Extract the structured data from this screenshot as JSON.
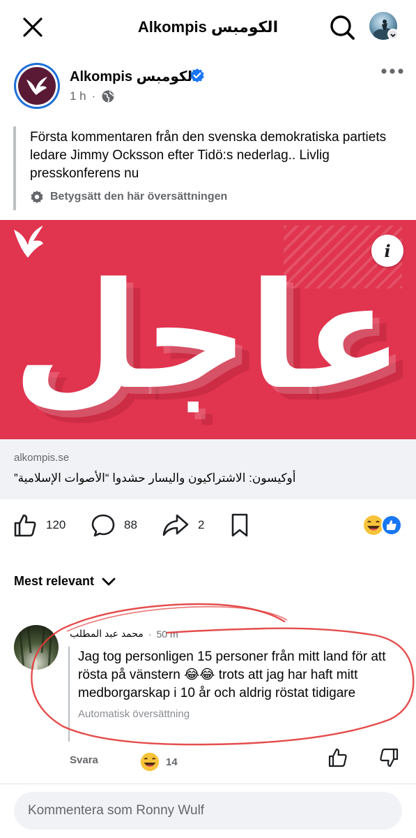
{
  "header": {
    "title": "Alkompis الكومبس"
  },
  "post": {
    "page_name": "Alkompis الكومبس",
    "time": "1 h",
    "text": "Första kommentaren från den svenska demokratiska partiets ledare Jimmy Ocksson efter Tidö:s nederlag.. Livlig presskonferens nu",
    "rate_translation": "Betygsätt den här översättningen",
    "image_word": "عاجل",
    "link_domain": "alkompis.se",
    "link_title": "أوكيسون: الاشتراكيون واليسار حشدوا “الأصوات الإسلامية”",
    "likes": "120",
    "comments": "88",
    "shares": "2"
  },
  "sort_label": "Mest relevant",
  "comment": {
    "author": "محمد عبد المطلب",
    "time": "50 m",
    "text": "Jag tog personligen 15 personer från mitt land för att rösta på vänstern 😂😂 trots att jag har haft mitt medborgarskap i 10 år och aldrig röstat tidigare",
    "auto_translation": "Automatisk översättning",
    "reply": "Svara",
    "reaction_emoji": "😄",
    "reaction_count": "14"
  },
  "composer": {
    "placeholder": "Kommentera som Ronny Wulf"
  },
  "colors": {
    "brand_red": "#e0344f",
    "facebook_blue": "#1877f2",
    "annotation_red": "#e23a3a"
  }
}
